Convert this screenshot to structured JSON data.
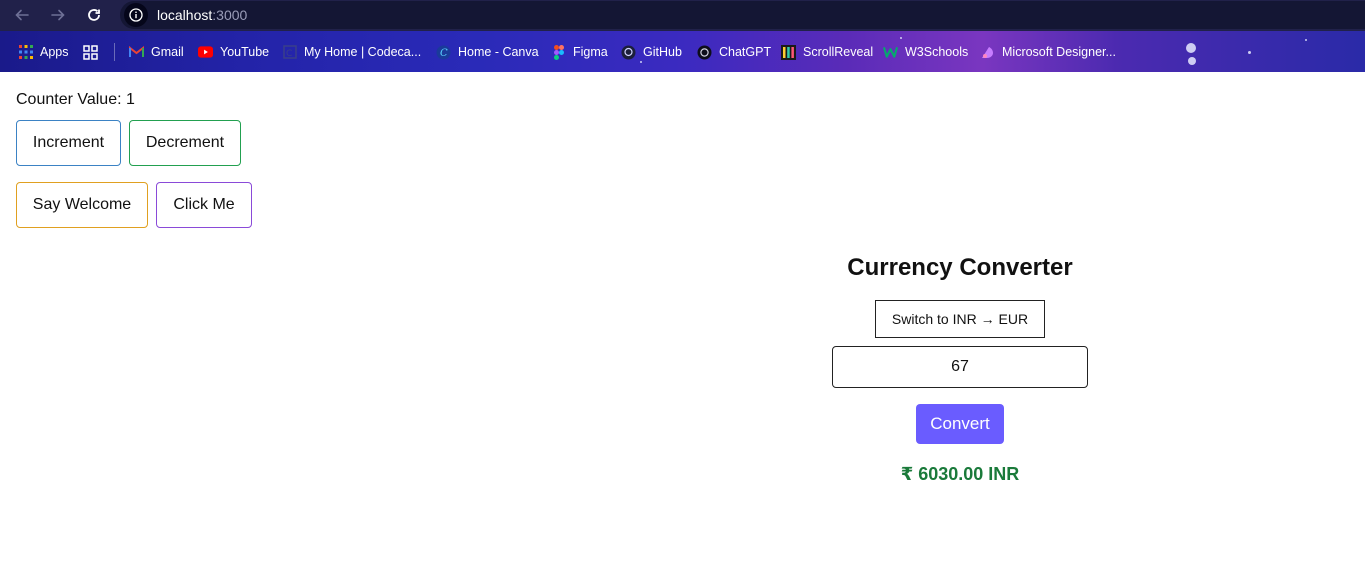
{
  "browser": {
    "url_host": "localhost",
    "url_port": ":3000",
    "bookmarks": [
      {
        "label": "Apps",
        "icon": "apps-grid-icon"
      },
      {
        "label": "",
        "icon": "tab-groups-icon"
      },
      {
        "label": "Gmail",
        "icon": "gmail-icon"
      },
      {
        "label": "YouTube",
        "icon": "youtube-icon"
      },
      {
        "label": "My Home | Codeca...",
        "icon": "codecademy-icon"
      },
      {
        "label": "Home - Canva",
        "icon": "canva-icon"
      },
      {
        "label": "Figma",
        "icon": "figma-icon"
      },
      {
        "label": "GitHub",
        "icon": "github-icon"
      },
      {
        "label": "ChatGPT",
        "icon": "chatgpt-icon"
      },
      {
        "label": "ScrollReveal",
        "icon": "scrollreveal-icon"
      },
      {
        "label": "W3Schools",
        "icon": "w3schools-icon"
      },
      {
        "label": "Microsoft Designer...",
        "icon": "microsoft-designer-icon"
      }
    ]
  },
  "counter": {
    "label": "Counter Value: 1",
    "increment_label": "Increment",
    "decrement_label": "Decrement",
    "welcome_label": "Say Welcome",
    "click_label": "Click Me"
  },
  "converter": {
    "title": "Currency Converter",
    "switch_label": "Switch to INR → EUR",
    "amount": "67",
    "convert_label": "Convert",
    "result": "₹ 6030.00 INR"
  },
  "colors": {
    "toolbar_bg": "#21214a",
    "convert_button": "#6a5cff",
    "result_text": "#1a7a3a",
    "increment_border": "#3b82c4",
    "decrement_border": "#22a050",
    "welcome_border": "#e0a020",
    "click_border": "#8a4ad8"
  }
}
